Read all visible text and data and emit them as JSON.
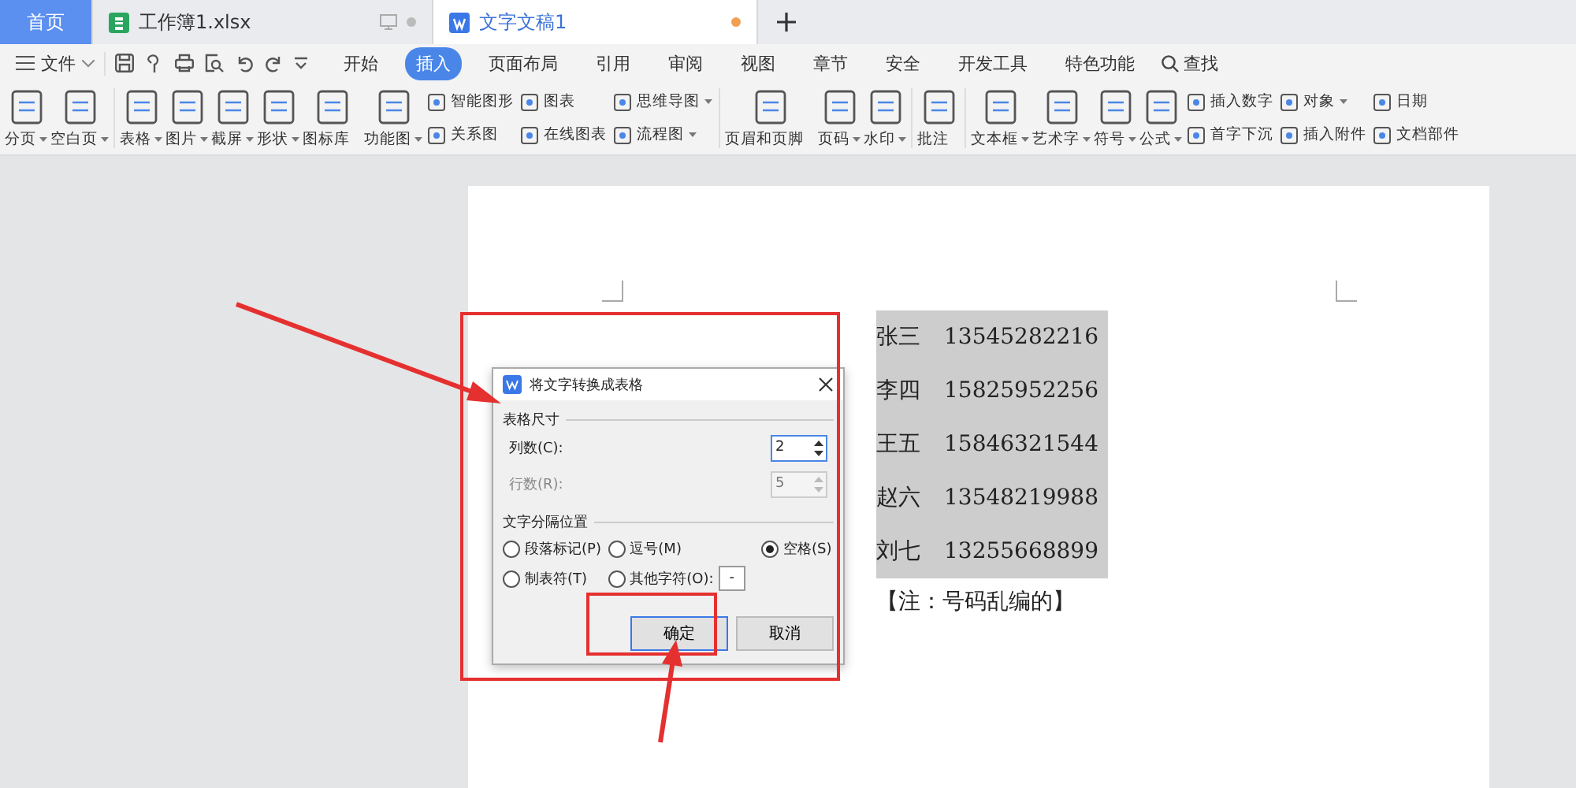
{
  "tabs": [
    {
      "label": "首页",
      "kind": "home",
      "selected": false
    },
    {
      "label": "工作簿1.xlsx",
      "kind": "sheet",
      "selected": false
    },
    {
      "label": "文字文稿1",
      "kind": "doc",
      "selected": true
    }
  ],
  "menu": {
    "file": "文件",
    "items": [
      {
        "label": "开始",
        "selected": false
      },
      {
        "label": "插入",
        "selected": true
      },
      {
        "label": "页面布局",
        "selected": false
      },
      {
        "label": "引用",
        "selected": false
      },
      {
        "label": "审阅",
        "selected": false
      },
      {
        "label": "视图",
        "selected": false
      },
      {
        "label": "章节",
        "selected": false
      },
      {
        "label": "安全",
        "selected": false
      },
      {
        "label": "开发工具",
        "selected": false
      },
      {
        "label": "特色功能",
        "selected": false
      }
    ],
    "search": "查找"
  },
  "ribbon": [
    {
      "kind": "large",
      "label": "分页",
      "dropdown": true
    },
    {
      "kind": "large",
      "label": "空白页",
      "dropdown": true
    },
    {
      "kind": "sep"
    },
    {
      "kind": "large",
      "label": "表格",
      "dropdown": true
    },
    {
      "kind": "large",
      "label": "图片",
      "dropdown": true
    },
    {
      "kind": "large",
      "label": "截屏",
      "dropdown": true
    },
    {
      "kind": "large",
      "label": "形状",
      "dropdown": true
    },
    {
      "kind": "large",
      "label": "图标库",
      "dropdown": false
    },
    {
      "kind": "large",
      "label": "功能图",
      "dropdown": true
    },
    {
      "kind": "stack",
      "items": [
        {
          "label": "智能图形",
          "dropdown": false
        },
        {
          "label": "关系图",
          "dropdown": false
        }
      ]
    },
    {
      "kind": "stack",
      "items": [
        {
          "label": "图表",
          "dropdown": false
        },
        {
          "label": "在线图表",
          "dropdown": false
        }
      ]
    },
    {
      "kind": "stack",
      "items": [
        {
          "label": "思维导图",
          "dropdown": true
        },
        {
          "label": "流程图",
          "dropdown": true
        }
      ]
    },
    {
      "kind": "sep"
    },
    {
      "kind": "large",
      "label": "页眉和页脚",
      "dropdown": false
    },
    {
      "kind": "large",
      "label": "页码",
      "dropdown": true
    },
    {
      "kind": "large",
      "label": "水印",
      "dropdown": true
    },
    {
      "kind": "sep"
    },
    {
      "kind": "large",
      "label": "批注",
      "dropdown": false
    },
    {
      "kind": "sep"
    },
    {
      "kind": "large",
      "label": "文本框",
      "dropdown": true
    },
    {
      "kind": "large",
      "label": "艺术字",
      "dropdown": true
    },
    {
      "kind": "large",
      "label": "符号",
      "dropdown": true
    },
    {
      "kind": "large",
      "label": "公式",
      "dropdown": true
    },
    {
      "kind": "stack",
      "items": [
        {
          "label": "插入数字",
          "dropdown": false
        },
        {
          "label": "首字下沉",
          "dropdown": false
        }
      ]
    },
    {
      "kind": "stack",
      "items": [
        {
          "label": "对象",
          "dropdown": true
        },
        {
          "label": "插入附件",
          "dropdown": false
        }
      ]
    },
    {
      "kind": "stack",
      "items": [
        {
          "label": "日期",
          "dropdown": false
        },
        {
          "label": "文档部件",
          "dropdown": false
        }
      ]
    }
  ],
  "document": {
    "rows": [
      {
        "name": "张三",
        "phone": "13545282216"
      },
      {
        "name": "李四",
        "phone": "15825952256"
      },
      {
        "name": "王五",
        "phone": "15846321544"
      },
      {
        "name": "赵六",
        "phone": "13548219988"
      },
      {
        "name": "刘七",
        "phone": "13255668899"
      }
    ],
    "note": "【注：号码乱编的】"
  },
  "dialog": {
    "title": "将文字转换成表格",
    "size_group": "表格尺寸",
    "fields": [
      {
        "label": "列数(C):",
        "value": "2",
        "disabled": false
      },
      {
        "label": "行数(R):",
        "value": "5",
        "disabled": true
      }
    ],
    "separator_group": "文字分隔位置",
    "options": [
      {
        "label": "段落标记(P)",
        "selected": false
      },
      {
        "label": "逗号(M)",
        "selected": false
      },
      {
        "label": "空格(S)",
        "selected": true
      },
      {
        "label": "制表符(T)",
        "selected": false
      },
      {
        "label": "其他字符(O):",
        "selected": false,
        "value": "-"
      }
    ],
    "buttons": [
      {
        "label": "确定",
        "default": true
      },
      {
        "label": "取消",
        "default": false
      }
    ]
  }
}
